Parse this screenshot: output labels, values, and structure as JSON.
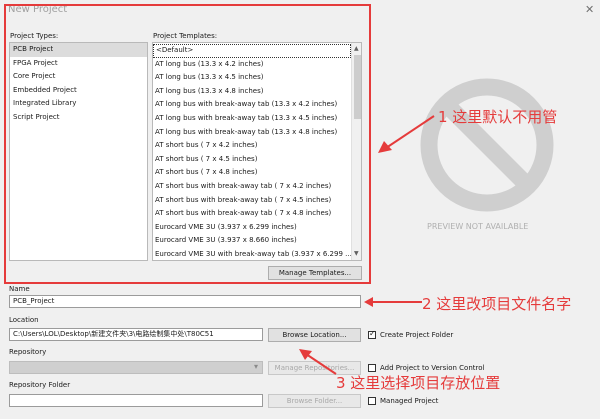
{
  "window": {
    "title": "New Project",
    "close_glyph": "✕"
  },
  "project_types": {
    "label": "Project Types:",
    "items": [
      "PCB Project",
      "FPGA Project",
      "Core Project",
      "Embedded Project",
      "Integrated Library",
      "Script Project"
    ],
    "selected_index": 0
  },
  "project_templates": {
    "label": "Project Templates:",
    "items": [
      "<Default>",
      "AT long bus (13.3 x 4.2 inches)",
      "AT long bus (13.3 x 4.5 inches)",
      "AT long bus (13.3 x 4.8 inches)",
      "AT long bus with break-away tab (13.3 x 4.2 inches)",
      "AT long bus with break-away tab (13.3 x 4.5 inches)",
      "AT long bus with break-away tab (13.3 x 4.8 inches)",
      "AT short bus ( 7 x 4.2 inches)",
      "AT short bus ( 7 x 4.5 inches)",
      "AT short bus ( 7 x 4.8 inches)",
      "AT short bus with break-away tab ( 7 x 4.2 inches)",
      "AT short bus with break-away tab ( 7 x 4.5 inches)",
      "AT short bus with break-away tab ( 7 x 4.8 inches)",
      "Eurocard VME 3U (3.937 x 6.299 inches)",
      "Eurocard VME 3U (3.937 x 8.660 inches)",
      "Eurocard VME 3U with break-away tab (3.937 x 6.299 ..."
    ],
    "selected_index": 0,
    "manage_button": "Manage Templates..."
  },
  "preview": {
    "text": "PREVIEW NOT AVAILABLE",
    "icon": "no-preview-icon",
    "color": "#c8c8c8"
  },
  "name": {
    "label": "Name",
    "value": "PCB_Project"
  },
  "location": {
    "label": "Location",
    "value": "C:\\Users\\LOL\\Desktop\\新建文件夹\\3\\电路绘制集中处\\T80C51",
    "browse_button": "Browse Location...",
    "create_folder_label": "Create Project Folder",
    "create_folder_checked": true
  },
  "repository": {
    "label": "Repository",
    "manage_button": "Manage Repositories...",
    "add_vc_label": "Add Project to Version Control",
    "add_vc_checked": false
  },
  "repository_folder": {
    "label": "Repository Folder",
    "browse_button": "Browse Folder...",
    "managed_label": "Managed Project",
    "managed_checked": false
  },
  "annotations": {
    "a1": "1 这里默认不用管",
    "a2": "2 这里改项目文件名字",
    "a3": "3 这里选择项目存放位置",
    "color": "#e53b3b"
  },
  "check_glyph": "✓",
  "dropdown_glyph": "▾"
}
